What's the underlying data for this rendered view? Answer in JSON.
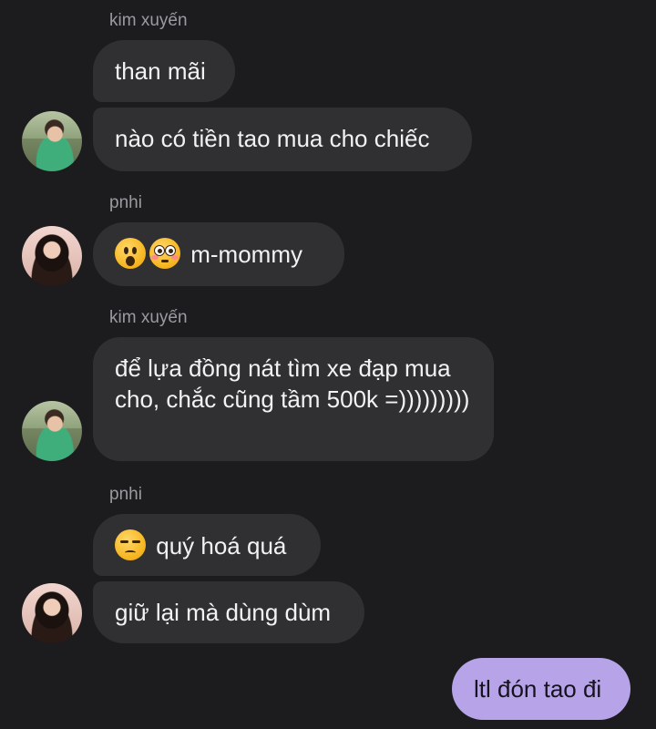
{
  "messages": [
    {
      "sender": "kim xuyến",
      "text": "than mãi"
    },
    {
      "text": "nào có tiền tao mua cho chiếc"
    },
    {
      "sender": "pnhi",
      "emojis": [
        "hushed-face-emoji",
        "flushed-face-emoji"
      ],
      "text": "m-mommy"
    },
    {
      "sender": "kim xuyến",
      "text": "để lựa đồng nát tìm xe đạp mua cho, chắc cũng tầm 500k =)))))))))"
    },
    {
      "sender": "pnhi",
      "emojis": [
        "unamused-face-emoji"
      ],
      "text": "quý hoá quá"
    },
    {
      "text": "giữ lại mà dùng dùm"
    },
    {
      "own": true,
      "text": "ltl đón tao đi"
    }
  ],
  "colors": {
    "background": "#1c1c1e",
    "incoming_bubble": "#303033",
    "outgoing_bubble": "#b7a4e8",
    "sender_name": "#9a9aa0"
  }
}
